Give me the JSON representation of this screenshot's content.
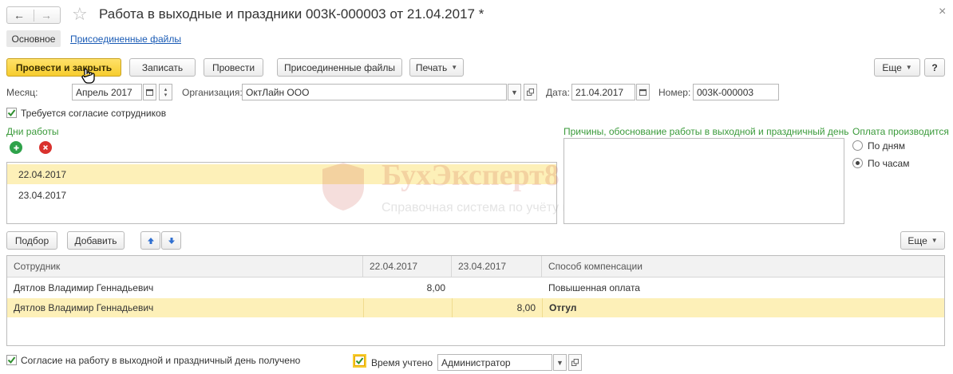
{
  "window": {
    "title": "Работа в выходные и праздники 003К-000003 от 21.04.2017 *",
    "back_glyph": "←",
    "forward_glyph": "→",
    "star_glyph": "☆",
    "close_glyph": "×"
  },
  "tabs": [
    {
      "label": "Основное"
    },
    {
      "label": "Присоединенные файлы"
    }
  ],
  "toolbar": {
    "post_close": "Провести и закрыть",
    "write": "Записать",
    "post": "Провести",
    "attached": "Присоединенные файлы",
    "print": "Печать",
    "more": "Еще",
    "help": "?"
  },
  "header": {
    "month_label": "Месяц:",
    "month_value": "Апрель 2017",
    "org_label": "Организация:",
    "org_value": "ОктЛайн ООО",
    "date_label": "Дата:",
    "date_value": "21.04.2017",
    "number_label": "Номер:",
    "number_value": "003К-000003"
  },
  "consent_required": {
    "label": "Требуется согласие сотрудников",
    "checked": true
  },
  "work_days": {
    "title": "Дни работы",
    "items": [
      "22.04.2017",
      "23.04.2017"
    ],
    "selected_index": 0
  },
  "reasons": {
    "title": "Причины, обоснование работы в выходной и праздничный день",
    "value": ""
  },
  "payment": {
    "title": "Оплата производится",
    "options": [
      "По дням",
      "По часам"
    ],
    "selected_index": 1
  },
  "watermark": {
    "brand": "БухЭксперт8",
    "subtitle": "Справочная система по учёту в 1С"
  },
  "table_toolbar": {
    "pick": "Подбор",
    "add": "Добавить",
    "more": "Еще"
  },
  "employees": {
    "columns": [
      "Сотрудник",
      "22.04.2017",
      "23.04.2017",
      "Способ компенсации"
    ],
    "rows": [
      [
        "Дятлов Владимир Геннадьевич",
        "8,00",
        "",
        "Повышенная оплата"
      ],
      [
        "Дятлов Владимир Геннадьевич",
        "",
        "8,00",
        "Отгул"
      ]
    ],
    "selected_index": 1
  },
  "footer": {
    "consent_received": {
      "label": "Согласие на работу в выходной и праздничный день получено",
      "checked": true
    },
    "time_accounted": {
      "label": "Время учтено",
      "checked": true
    },
    "user_value": "Администратор"
  },
  "colors": {
    "accent_yellow": "#f6cc2e",
    "selection": "#fdf0b8",
    "green_title": "#3a9a3a",
    "link_blue": "#1a5bb5"
  }
}
